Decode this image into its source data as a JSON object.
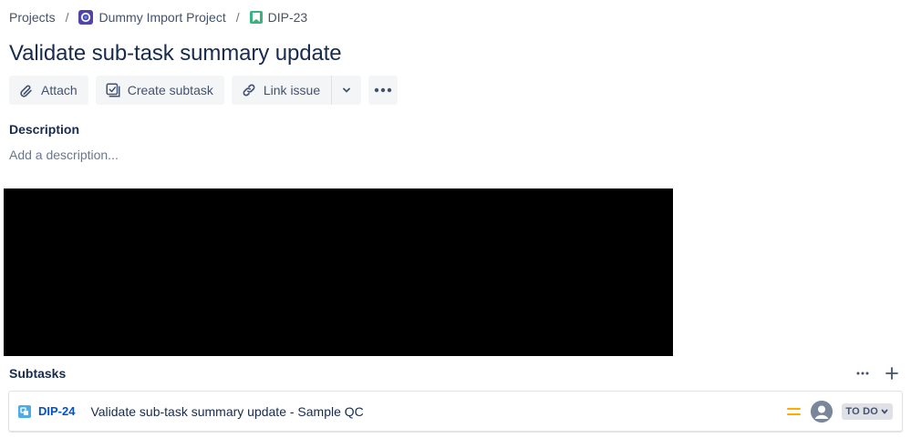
{
  "breadcrumb": {
    "projects": "Projects",
    "project_name": "Dummy Import Project",
    "issue_key": "DIP-23",
    "separator": "/"
  },
  "issue": {
    "title": "Validate sub-task summary update"
  },
  "toolbar": {
    "attach_label": "Attach",
    "create_subtask_label": "Create subtask",
    "link_issue_label": "Link issue"
  },
  "description": {
    "label": "Description",
    "placeholder": "Add a description..."
  },
  "subtasks": {
    "label": "Subtasks",
    "items": [
      {
        "key": "DIP-24",
        "summary": "Validate sub-task summary update - Sample QC",
        "priority_icon": "priority-medium-icon",
        "status": "TO DO"
      }
    ]
  },
  "colors": {
    "project_icon": "#5243aa",
    "story_icon": "#36b37e",
    "subtask_icon": "#4bade8",
    "priority_medium": "#ffab00",
    "link_blue": "#0052cc",
    "button_bg": "#f4f5f7"
  }
}
